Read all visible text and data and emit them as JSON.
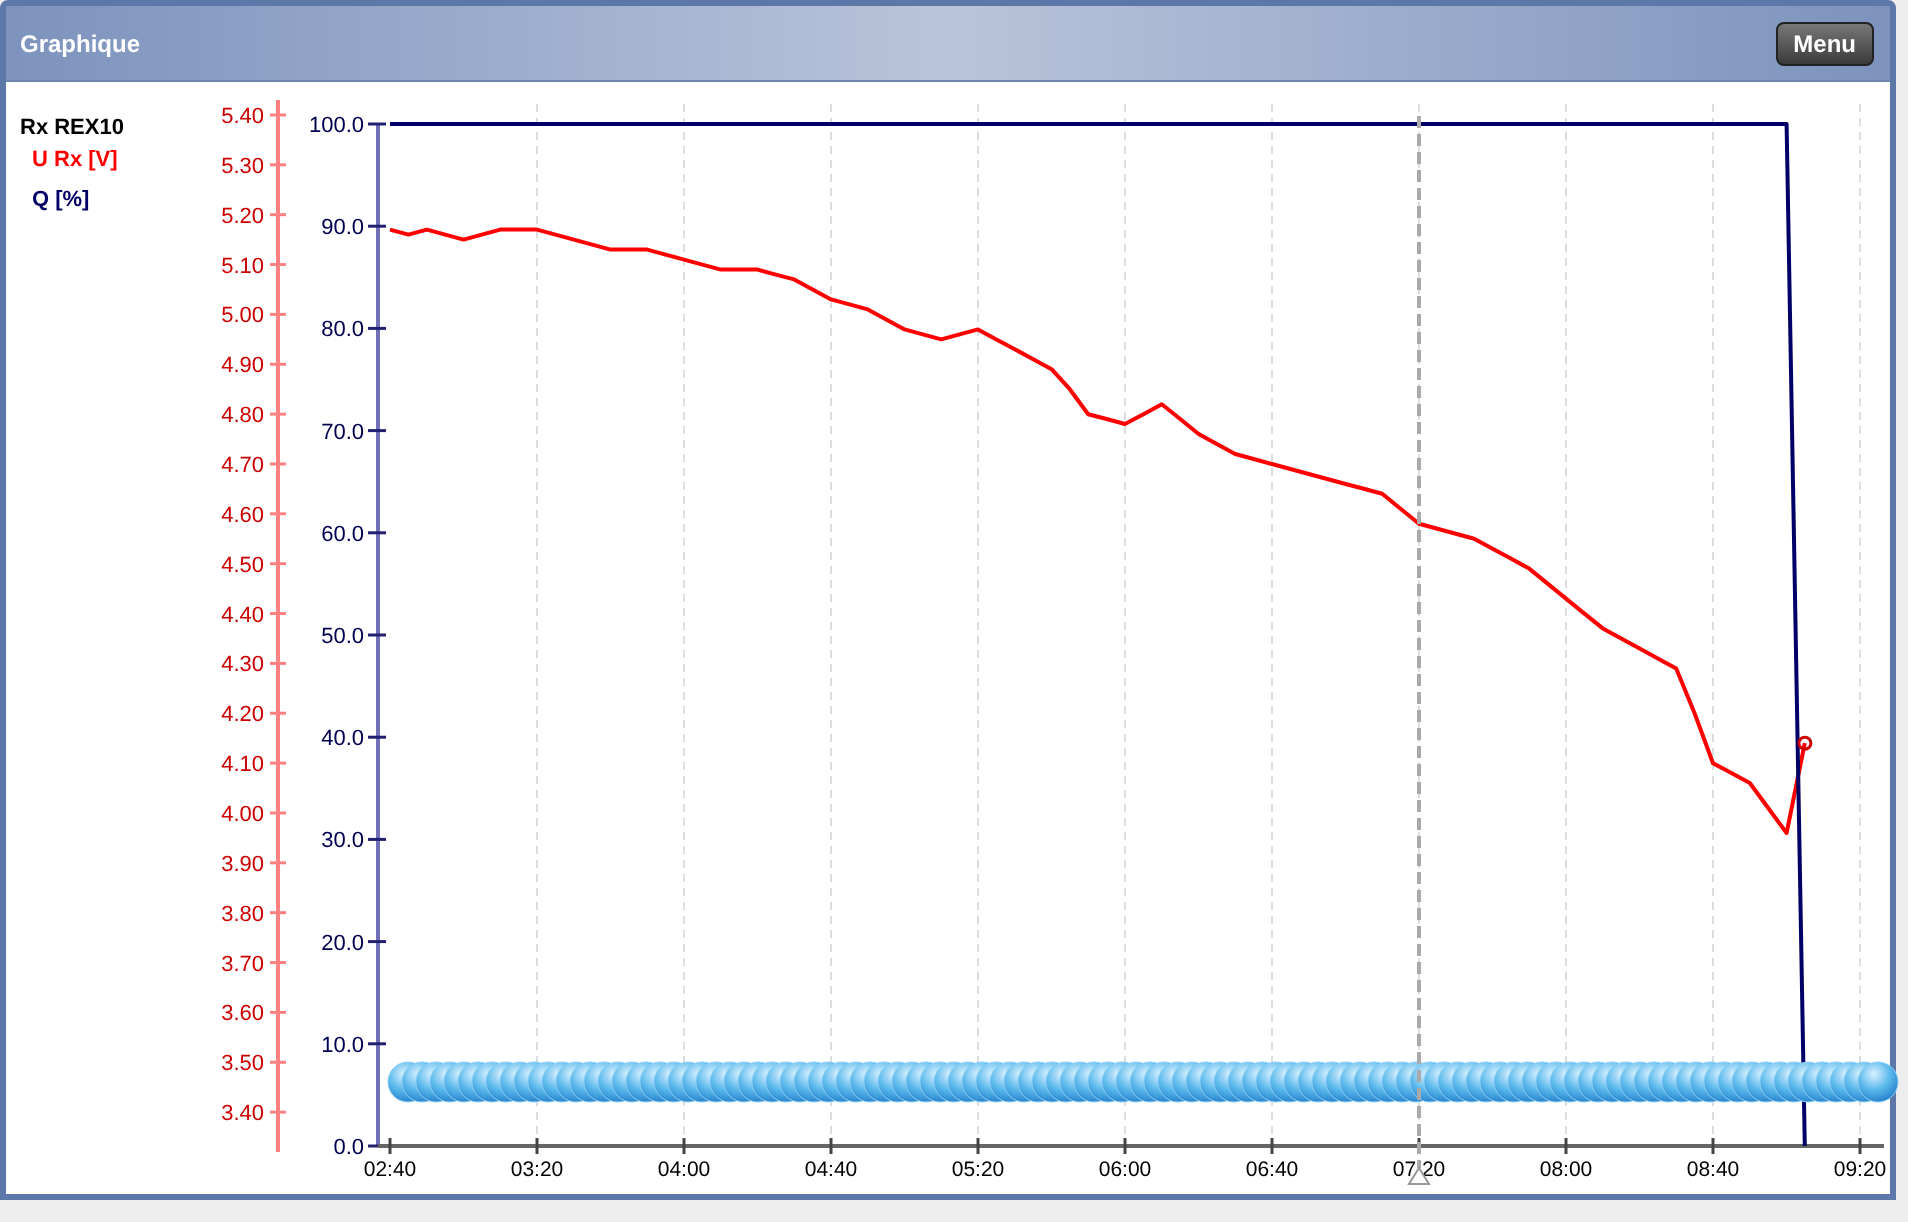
{
  "panel": {
    "title": "Graphique",
    "menu_button": "Menu"
  },
  "chart": {
    "chart_data": {
      "type": "line",
      "title": "Rx REX10",
      "categories": [
        "02:40",
        null,
        null,
        null,
        null,
        null,
        null,
        null,
        "03:20",
        null,
        null,
        null,
        null,
        null,
        null,
        null,
        "04:00",
        null,
        null,
        null,
        null,
        null,
        null,
        null,
        "04:40",
        null,
        null,
        null,
        null,
        null,
        null,
        null,
        "05:20",
        null,
        null,
        null,
        null,
        null,
        null,
        null,
        "06:00",
        null,
        null,
        null,
        null,
        null,
        null,
        null,
        "06:40",
        null,
        null,
        null,
        null,
        null,
        null,
        null,
        "07:20",
        null,
        null,
        null,
        null,
        null,
        null,
        null,
        "08:00",
        null,
        null,
        null,
        null,
        null,
        null,
        null,
        "08:40",
        null,
        null,
        null,
        null,
        null,
        null,
        null,
        "09:20"
      ],
      "series": [
        {
          "name": "U Rx [V]",
          "color": "#ff0000",
          "axis": "y2",
          "values": [
            5.17,
            5.16,
            5.17,
            5.16,
            5.15,
            5.16,
            5.17,
            5.17,
            5.17,
            5.16,
            5.15,
            5.14,
            5.13,
            5.13,
            5.13,
            5.12,
            5.11,
            5.1,
            5.09,
            5.09,
            5.09,
            5.08,
            5.07,
            5.05,
            5.03,
            5.02,
            5.01,
            4.99,
            4.97,
            4.96,
            4.95,
            4.96,
            4.97,
            4.95,
            4.93,
            4.91,
            4.89,
            4.85,
            4.8,
            4.79,
            4.78,
            4.8,
            4.82,
            4.79,
            4.76,
            4.74,
            4.72,
            4.71,
            4.7,
            4.69,
            4.68,
            4.67,
            4.66,
            4.65,
            4.64,
            4.61,
            4.58,
            4.57,
            4.56,
            4.55,
            4.53,
            4.51,
            4.49,
            4.46,
            4.43,
            4.4,
            4.37,
            4.35,
            4.33,
            4.31,
            4.29,
            4.2,
            4.1,
            4.08,
            4.06,
            4.01,
            3.96,
            4.14,
            null,
            null,
            null
          ]
        },
        {
          "name": "Q [%]",
          "color": "#000066",
          "values": [
            100,
            100,
            100,
            100,
            100,
            100,
            100,
            100,
            100,
            100,
            100,
            100,
            100,
            100,
            100,
            100,
            100,
            100,
            100,
            100,
            100,
            100,
            100,
            100,
            100,
            100,
            100,
            100,
            100,
            100,
            100,
            100,
            100,
            100,
            100,
            100,
            100,
            100,
            100,
            100,
            100,
            100,
            100,
            100,
            100,
            100,
            100,
            100,
            100,
            100,
            100,
            100,
            100,
            100,
            100,
            100,
            100,
            100,
            100,
            100,
            100,
            100,
            100,
            100,
            100,
            100,
            100,
            100,
            100,
            100,
            100,
            100,
            100,
            100,
            100,
            100,
            100,
            0,
            null,
            null,
            null
          ]
        }
      ],
      "ylim": [
        0,
        100
      ],
      "yticks": [
        {
          "value": 0,
          "label": "0.0"
        },
        {
          "value": 10,
          "label": "10.0"
        },
        {
          "value": 20,
          "label": "20.0"
        },
        {
          "value": 30,
          "label": "30.0"
        },
        {
          "value": 40,
          "label": "40.0"
        },
        {
          "value": 50,
          "label": "50.0"
        },
        {
          "value": 60,
          "label": "60.0"
        },
        {
          "value": 70,
          "label": "70.0"
        },
        {
          "value": 80,
          "label": "80.0"
        },
        {
          "value": 90,
          "label": "90.0"
        },
        {
          "value": 100,
          "label": "100.0"
        }
      ],
      "y2lim": [
        3.32,
        5.43
      ],
      "y2ticks": [
        {
          "value": 3.4,
          "label": "3.40"
        },
        {
          "value": 3.5,
          "label": "3.50"
        },
        {
          "value": 3.6,
          "label": "3.60"
        },
        {
          "value": 3.7,
          "label": "3.70"
        },
        {
          "value": 3.8,
          "label": "3.80"
        },
        {
          "value": 3.9,
          "label": "3.90"
        },
        {
          "value": 4.0,
          "label": "4.00"
        },
        {
          "value": 4.1,
          "label": "4.10"
        },
        {
          "value": 4.2,
          "label": "4.20"
        },
        {
          "value": 4.3,
          "label": "4.30"
        },
        {
          "value": 4.4,
          "label": "4.40"
        },
        {
          "value": 4.5,
          "label": "4.50"
        },
        {
          "value": 4.6,
          "label": "4.60"
        },
        {
          "value": 4.7,
          "label": "4.70"
        },
        {
          "value": 4.8,
          "label": "4.80"
        },
        {
          "value": 4.9,
          "label": "4.90"
        },
        {
          "value": 5.0,
          "label": "5.00"
        },
        {
          "value": 5.1,
          "label": "5.10"
        },
        {
          "value": 5.2,
          "label": "5.20"
        },
        {
          "value": 5.3,
          "label": "5.30"
        },
        {
          "value": 5.4,
          "label": "5.40"
        }
      ],
      "grid": true,
      "ref_lines": [
        {
          "axis": "x",
          "value": "07:20"
        }
      ]
    }
  }
}
